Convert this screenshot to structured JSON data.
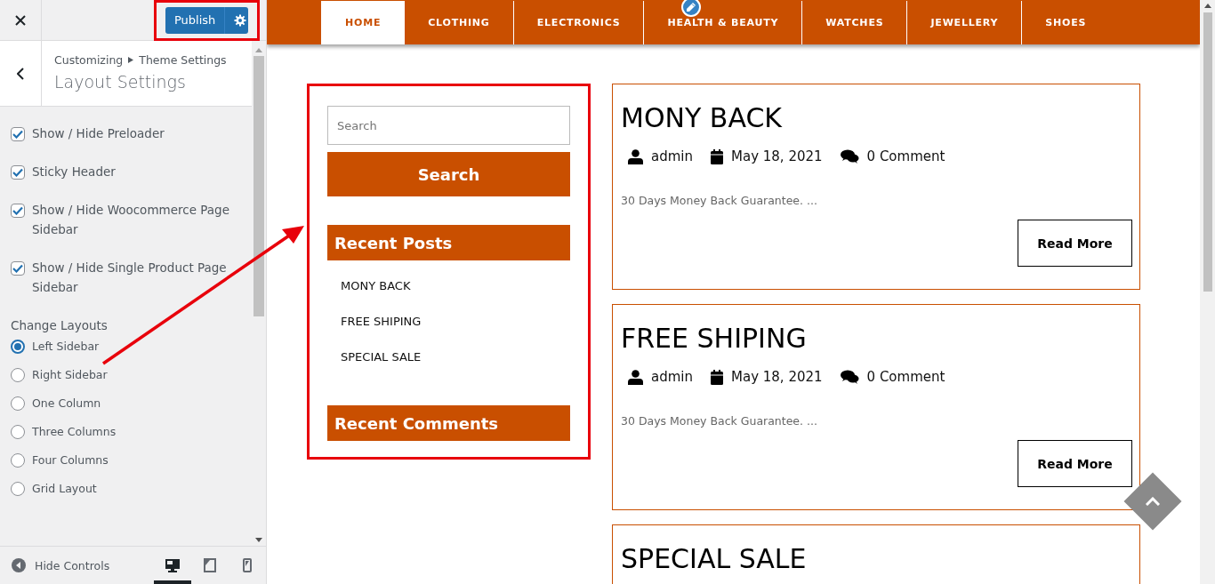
{
  "customizer": {
    "publish_button": "Publish",
    "breadcrumb": [
      "Customizing",
      "Theme Settings"
    ],
    "section_title": "Layout Settings",
    "options": [
      {
        "label": "Show / Hide Preloader",
        "checked": true
      },
      {
        "label": "Sticky Header",
        "checked": true
      },
      {
        "label": "Show / Hide Woocommerce Page Sidebar",
        "checked": true
      },
      {
        "label": "Show / Hide Single Product Page Sidebar",
        "checked": true
      }
    ],
    "layout_heading": "Change Layouts",
    "layouts": [
      {
        "label": "Left Sidebar",
        "selected": true
      },
      {
        "label": "Right Sidebar",
        "selected": false
      },
      {
        "label": "One Column",
        "selected": false
      },
      {
        "label": "Three Columns",
        "selected": false
      },
      {
        "label": "Four Columns",
        "selected": false
      },
      {
        "label": "Grid Layout",
        "selected": false
      }
    ],
    "hide_controls": "Hide Controls",
    "devices": [
      {
        "kind": "desktop",
        "selected": true
      },
      {
        "kind": "tablet",
        "selected": false
      },
      {
        "kind": "mobile",
        "selected": false
      }
    ]
  },
  "preview": {
    "nav": [
      {
        "label": "HOME",
        "selected": true
      },
      {
        "label": "CLOTHING",
        "selected": false
      },
      {
        "label": "ELECTRONICS",
        "selected": false
      },
      {
        "label": "HEALTH & BEAUTY",
        "selected": false
      },
      {
        "label": "WATCHES",
        "selected": false
      },
      {
        "label": "JEWELLERY",
        "selected": false
      },
      {
        "label": "SHOES",
        "selected": false
      }
    ],
    "sidebar": {
      "search_placeholder": "Search",
      "search_button": "Search",
      "recent_posts_title": "Recent Posts",
      "recent_posts": [
        "MONY BACK",
        "FREE SHIPING",
        "SPECIAL SALE"
      ],
      "recent_comments_title": "Recent Comments"
    },
    "posts": [
      {
        "title": "MONY BACK",
        "author": "admin",
        "date": "May 18, 2021",
        "comments": "0 Comment",
        "excerpt": "30 Days Money Back Guarantee. ...",
        "button": "Read More"
      },
      {
        "title": "FREE SHIPING",
        "author": "admin",
        "date": "May 18, 2021",
        "comments": "0 Comment",
        "excerpt": "30 Days Money Back Guarantee. ...",
        "button": "Read More"
      },
      {
        "title": "SPECIAL SALE"
      }
    ]
  }
}
